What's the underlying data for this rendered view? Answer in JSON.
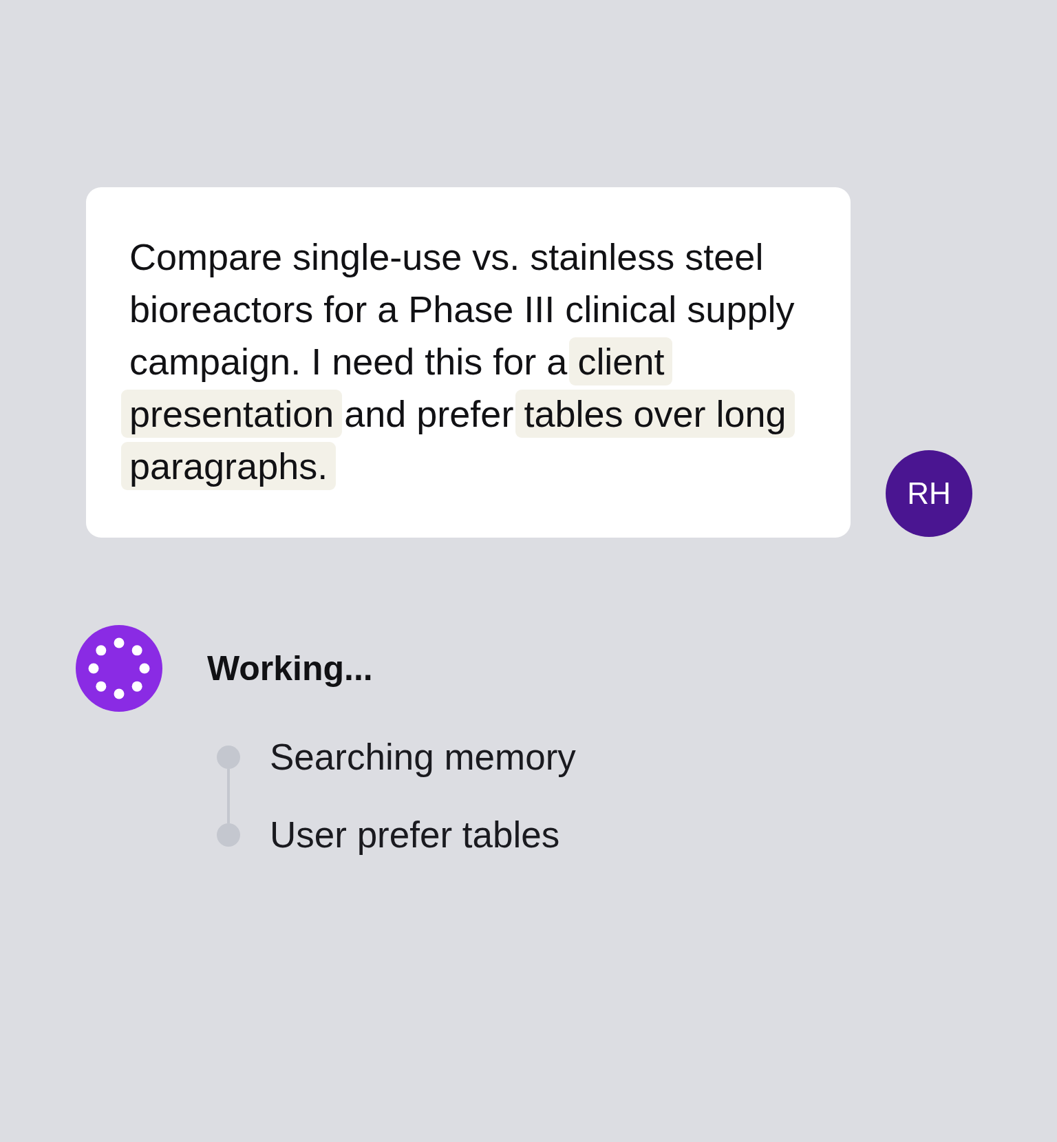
{
  "message": {
    "segments": [
      {
        "text": "Compare single-use vs. stainless steel bioreactors for a Phase III clinical supply campaign. I need this for a ",
        "highlighted": false
      },
      {
        "text": "client presentation",
        "highlighted": true
      },
      {
        "text": " and prefer ",
        "highlighted": false
      },
      {
        "text": "tables over long paragraphs.",
        "highlighted": true
      }
    ]
  },
  "user_avatar": {
    "initials": "RH"
  },
  "assistant": {
    "status": "Working...",
    "steps": [
      "Searching memory",
      "User prefer tables"
    ]
  }
}
